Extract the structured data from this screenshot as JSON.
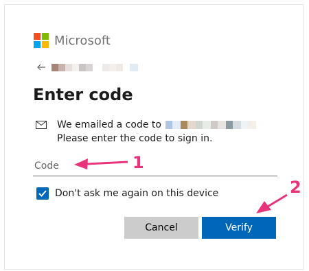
{
  "brand": {
    "name": "Microsoft"
  },
  "heading": "Enter code",
  "message": {
    "line1_prefix": "We emailed a code to",
    "line2": "Please enter the code to sign in."
  },
  "code_input": {
    "placeholder": "Code",
    "value": ""
  },
  "remember": {
    "label": "Don't ask me again on this device",
    "checked": true
  },
  "buttons": {
    "cancel": "Cancel",
    "verify": "Verify"
  },
  "annotations": {
    "step1": "1",
    "step2": "2"
  },
  "colors": {
    "primary": "#0067b8",
    "annotation": "#e8327a",
    "cancel_bg": "#cccccc"
  }
}
